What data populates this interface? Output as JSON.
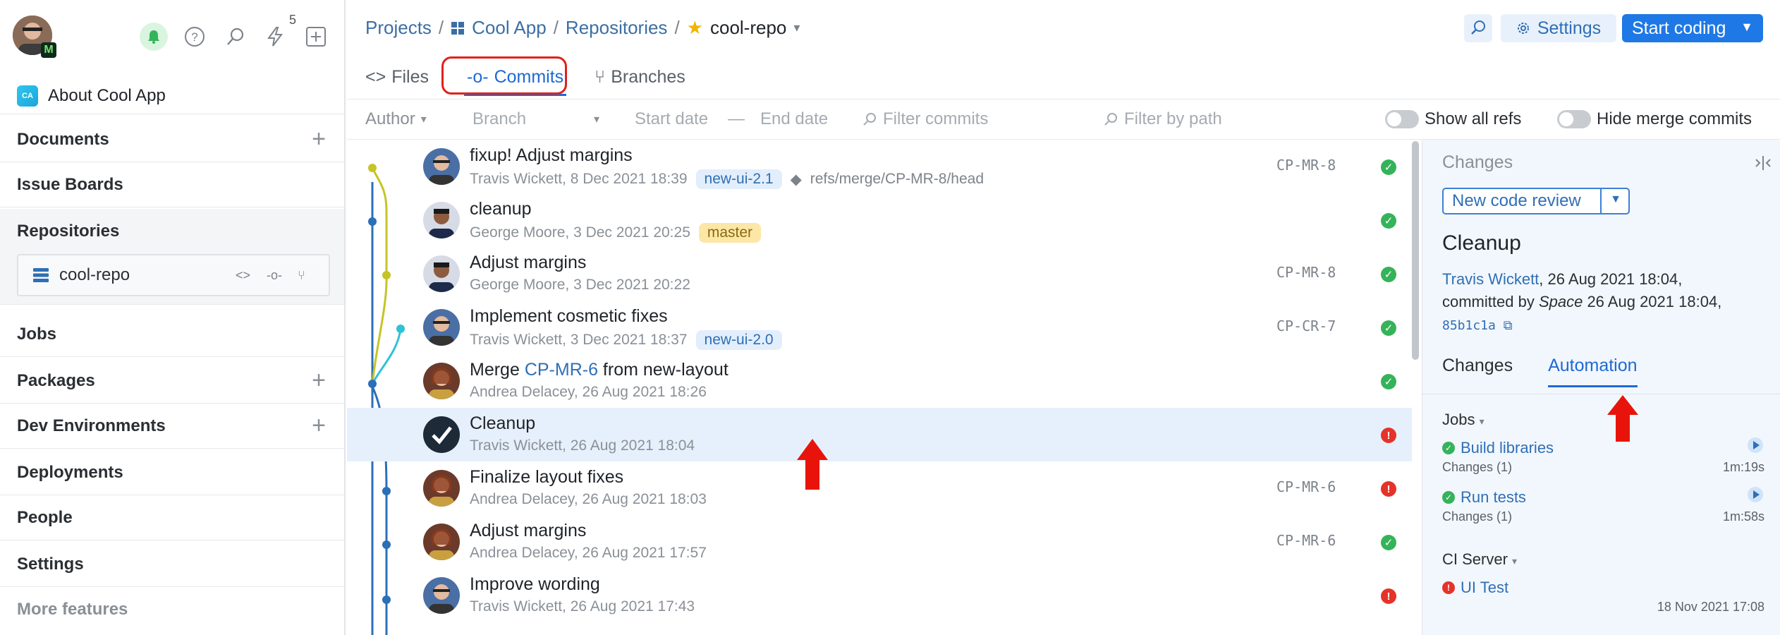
{
  "sidebar": {
    "avatar_badge": "M",
    "notifications_count": "5",
    "project_logo": "CA",
    "project_name": "About Cool App",
    "items": [
      {
        "label": "Documents"
      },
      {
        "label": "Issue Boards"
      },
      {
        "label": "Repositories"
      },
      {
        "label": "Jobs"
      },
      {
        "label": "Packages"
      },
      {
        "label": "Dev Environments"
      },
      {
        "label": "Deployments"
      },
      {
        "label": "People"
      },
      {
        "label": "Settings"
      },
      {
        "label": "More features"
      }
    ],
    "repo_name": "cool-repo"
  },
  "header": {
    "breadcrumb": {
      "projects": "Projects",
      "project": "Cool App",
      "repositories": "Repositories",
      "repo": "cool-repo"
    },
    "settings_label": "Settings",
    "start_coding_label": "Start coding"
  },
  "tabs": [
    {
      "label": "Files"
    },
    {
      "label": "Commits"
    },
    {
      "label": "Branches"
    }
  ],
  "filters": {
    "author": "Author",
    "branch": "Branch",
    "start_date": "Start date",
    "end_date": "End date",
    "filter_commits": "Filter commits",
    "filter_path": "Filter by path",
    "show_all_refs": "Show all refs",
    "hide_merge": "Hide merge commits"
  },
  "commits": [
    {
      "title": "fixup! Adjust margins",
      "meta": "Travis Wickett, 8 Dec 2021 18:39",
      "tag": "new-ui-2.1",
      "ref": "refs/merge/CP-MR-8/head",
      "code": "CP-MR-8",
      "status": "ok"
    },
    {
      "title": "cleanup",
      "meta": "George Moore, 3 Dec 2021 20:25",
      "tag": "master",
      "code": "",
      "status": "ok"
    },
    {
      "title": "Adjust margins",
      "meta": "George Moore, 3 Dec 2021 20:22",
      "code": "CP-MR-8",
      "status": "ok"
    },
    {
      "title": "Implement cosmetic fixes",
      "meta": "Travis Wickett, 3 Dec 2021 18:37",
      "tag": "new-ui-2.0",
      "code": "CP-CR-7",
      "status": "ok"
    },
    {
      "title_pre": "Merge ",
      "title_link": "CP-MR-6",
      "title_post": " from new-layout",
      "meta": "Andrea Delacey, 26 Aug 2021 18:26",
      "code": "",
      "status": "ok"
    },
    {
      "title": "Cleanup",
      "meta": "Travis Wickett, 26 Aug 2021 18:04",
      "code": "",
      "status": "err"
    },
    {
      "title": "Finalize layout fixes",
      "meta": "Andrea Delacey, 26 Aug 2021 18:03",
      "code": "CP-MR-6",
      "status": "err"
    },
    {
      "title": "Adjust margins",
      "meta": "Andrea Delacey, 26 Aug 2021 17:57",
      "code": "CP-MR-6",
      "status": "ok"
    },
    {
      "title": "Improve wording",
      "meta": "Travis Wickett, 26 Aug 2021 17:43",
      "code": "",
      "status": "err"
    }
  ],
  "panel": {
    "header": "Changes",
    "new_code_review": "New code review",
    "title": "Cleanup",
    "author": "Travis Wickett",
    "date1": ", 26 Aug 2021 18:04,",
    "committed_by": "committed by ",
    "committer": "Space",
    "date2": " 26 Aug 2021 18:04,",
    "hash": "85b1c1a",
    "tabs": [
      {
        "label": "Changes"
      },
      {
        "label": "Automation"
      }
    ],
    "jobs_label": "Jobs",
    "jobs": [
      {
        "name": "Build libraries",
        "changes": "Changes (1)",
        "duration": "1m:19s"
      },
      {
        "name": "Run tests",
        "changes": "Changes (1)",
        "duration": "1m:58s"
      }
    ],
    "ci_label": "CI Server",
    "ci_item": "UI Test",
    "ci_date": "18 Nov 2021 17:08"
  },
  "colors": {
    "accent": "#1e78e6",
    "ok": "#35b35a",
    "error": "#e5332a",
    "annotation": "#e0221c"
  }
}
